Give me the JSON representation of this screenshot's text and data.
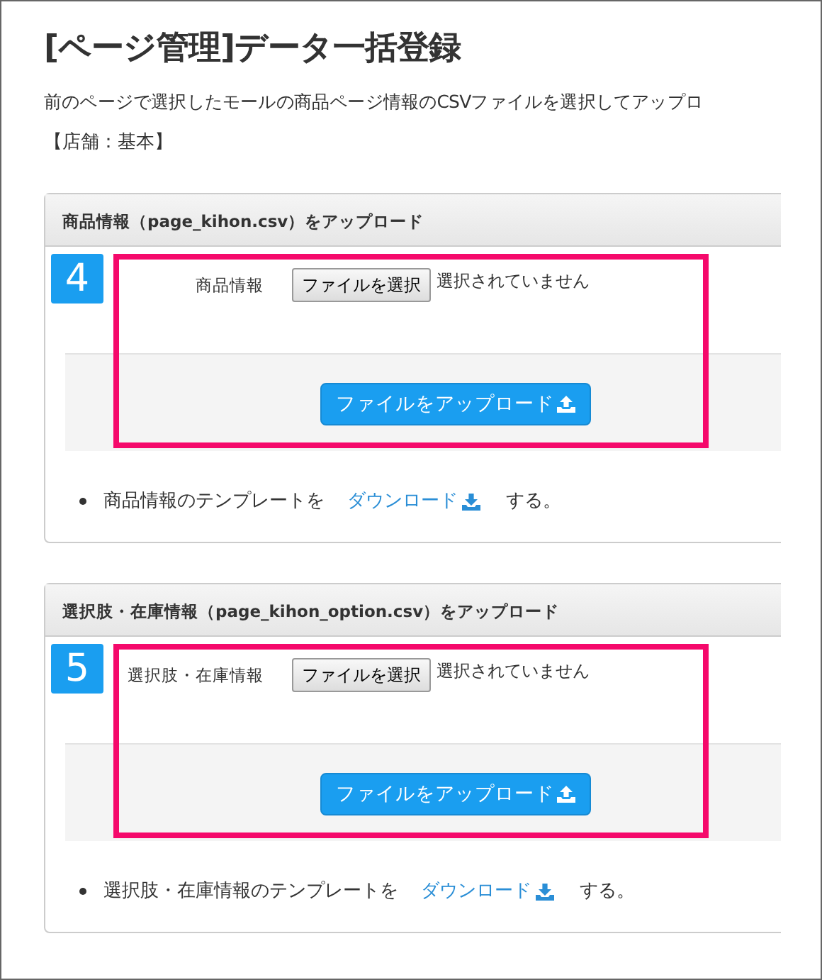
{
  "title": "[ページ管理]データ一括登録",
  "description": "前のページで選択したモールの商品ページ情報のCSVファイルを選択してアップロ",
  "store": "【店舗：基本】",
  "sections": [
    {
      "header": "商品情報（page_kihon.csv）をアップロード",
      "step": "4",
      "field_label": "商品情報",
      "choose_button": "ファイルを選択",
      "file_status": "選択されていません",
      "upload_button": "ファイルをアップロード",
      "template_text": "商品情報のテンプレートを",
      "download_link": "ダウンロード",
      "suffix": "する。"
    },
    {
      "header": "選択肢・在庫情報（page_kihon_option.csv）をアップロード",
      "step": "5",
      "field_label": "選択肢・在庫情報",
      "choose_button": "ファイルを選択",
      "file_status": "選択されていません",
      "upload_button": "ファイルをアップロード",
      "template_text": "選択肢・在庫情報のテンプレートを",
      "download_link": "ダウンロード",
      "suffix": "する。"
    }
  ]
}
